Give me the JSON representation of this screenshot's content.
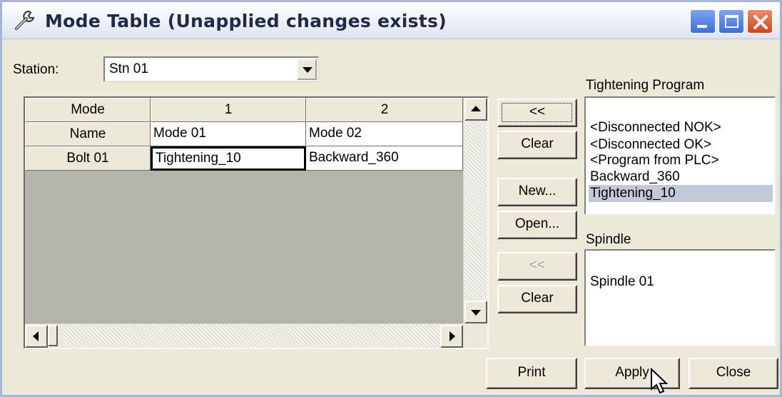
{
  "window": {
    "title": "Mode Table (Unapplied changes exists)",
    "title_icon": "wrench-icon",
    "controls": [
      "minimize",
      "maximize",
      "close"
    ]
  },
  "station": {
    "label": "Station:",
    "value": "Stn 01"
  },
  "mode_grid": {
    "rows": [
      {
        "header": "Mode",
        "cells": [
          "1",
          "2"
        ]
      },
      {
        "header": "Name",
        "cells": [
          "Mode 01",
          "Mode 02"
        ]
      },
      {
        "header": "Bolt 01",
        "cells": [
          "Tightening_10",
          "Backward_360"
        ]
      }
    ],
    "selected_cell": "Tightening_10"
  },
  "middle_buttons": {
    "assign_program": "<<",
    "clear_program": "Clear",
    "new": "New...",
    "open": "Open...",
    "assign_spindle": "<<",
    "clear_spindle": "Clear"
  },
  "tightening_program": {
    "label": "Tightening Program",
    "items": [
      "<Disconnected NOK>",
      "<Disconnected OK>",
      "<Program from PLC>",
      "Backward_360",
      "Tightening_10"
    ],
    "selected": "Tightening_10"
  },
  "spindle": {
    "label": "Spindle",
    "items": [
      "Spindle 01"
    ]
  },
  "footer": {
    "print": "Print",
    "apply": "Apply",
    "close": "Close"
  },
  "colors": {
    "window_bg": "#ece9d8",
    "selection": "#c3c9d8",
    "close_button": "#d2431c",
    "title_button": "#3b6fd8"
  }
}
